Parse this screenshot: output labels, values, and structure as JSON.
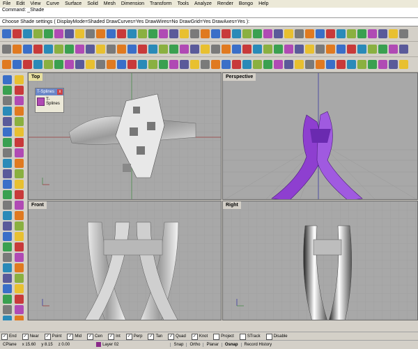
{
  "menu": [
    "File",
    "Edit",
    "View",
    "Curve",
    "Surface",
    "Solid",
    "Mesh",
    "Dimension",
    "Transform",
    "Tools",
    "Analyze",
    "Render",
    "Bongo",
    "Help"
  ],
  "command": {
    "history_line": "Command: _Shade",
    "prompt": "Choose Shade settings ( DisplayMode=Shaded  DrawCurves=Yes  DrawWires=No  DrawGrid=Yes  DrawAxes=Yes ):"
  },
  "viewports": {
    "top": {
      "title": "Top"
    },
    "perspective": {
      "title": "Perspective"
    },
    "front": {
      "title": "Front"
    },
    "right": {
      "title": "Right"
    }
  },
  "tsplines_panel": {
    "title": "T-Splines",
    "close": "x",
    "button_label": "T-Splines"
  },
  "osnap": [
    {
      "label": "End",
      "checked": true
    },
    {
      "label": "Near",
      "checked": true
    },
    {
      "label": "Point",
      "checked": true
    },
    {
      "label": "Mid",
      "checked": true
    },
    {
      "label": "Cen",
      "checked": true
    },
    {
      "label": "Int",
      "checked": true
    },
    {
      "label": "Perp",
      "checked": true
    },
    {
      "label": "Tan",
      "checked": true
    },
    {
      "label": "Quad",
      "checked": true
    },
    {
      "label": "Knot",
      "checked": true
    },
    {
      "label": "Project",
      "checked": false
    },
    {
      "label": "STrack",
      "checked": false
    },
    {
      "label": "Disable",
      "checked": false
    }
  ],
  "status": {
    "cplane": "CPlane",
    "x": "x 15.60",
    "y": "y 8.15",
    "z": "z 0.00",
    "layer": "Layer 02",
    "layer_color": "#8a2a8a",
    "snap": "Snap",
    "ortho": "Ortho",
    "planar": "Planar",
    "osnap": "Osnap",
    "record_history": "Record History"
  },
  "colors": {
    "ring_purple": "#8e3fd0",
    "grid_bg": "#a8a8a8",
    "grid_line": "#999999"
  }
}
